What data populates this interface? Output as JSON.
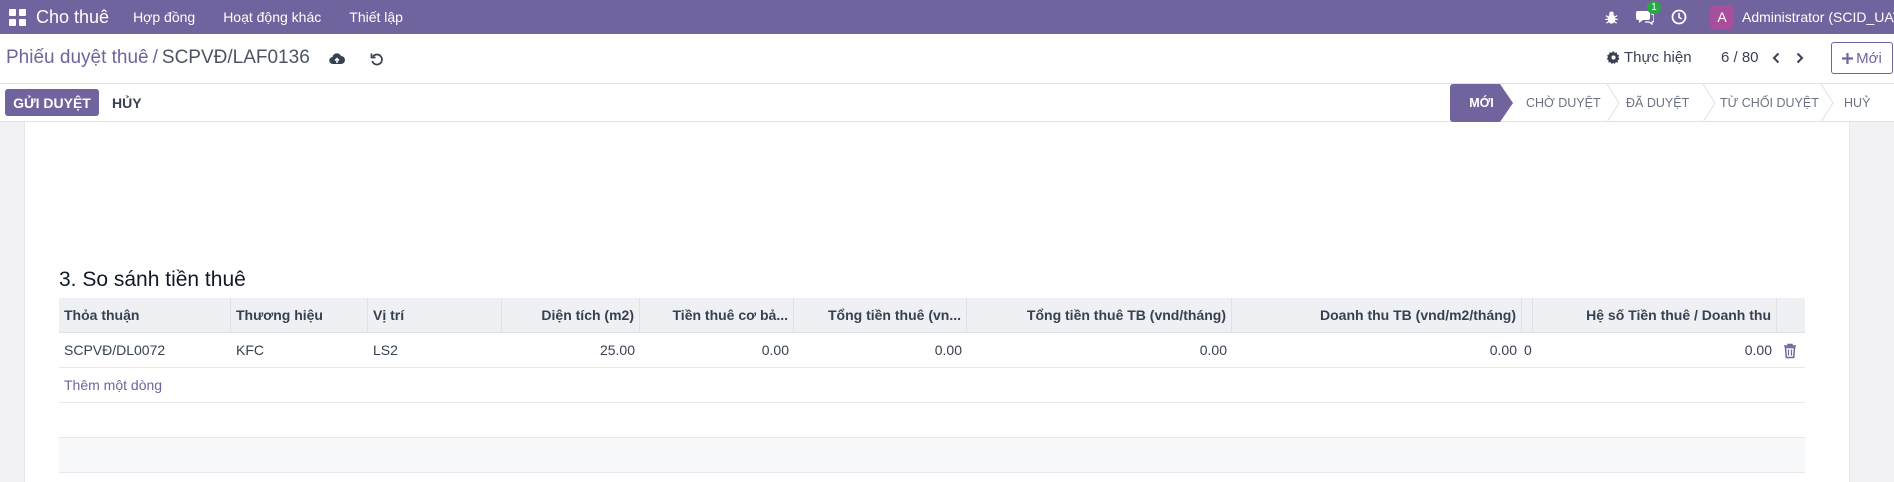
{
  "navbar": {
    "app_title": "Cho thuê",
    "menu": [
      "Hợp đồng",
      "Hoạt động khác",
      "Thiết lập"
    ],
    "messages_badge": "1",
    "avatar_letter": "A",
    "user": "Administrator (SCID_UAT)"
  },
  "control": {
    "breadcrumb_parent": "Phiếu duyệt thuê",
    "breadcrumb_sep": "/",
    "breadcrumb_current": "SCPVĐ/LAF0136",
    "action_label": "Thực hiện",
    "pager": "6 / 80",
    "new_label": "Mới"
  },
  "statusbar": {
    "submit_label": "GỬI DUYỆT",
    "cancel_label": "HỦY",
    "stages": [
      {
        "label": "MỚI",
        "active": true
      },
      {
        "label": "CHỜ DUYỆT",
        "active": false
      },
      {
        "label": "ĐÃ DUYỆT",
        "active": false
      },
      {
        "label": "TỪ CHỐI DUYỆT",
        "active": false
      },
      {
        "label": "HUỶ",
        "active": false
      }
    ]
  },
  "section": {
    "title": "3. So sánh tiền thuê"
  },
  "table": {
    "headers": [
      "Thỏa thuận",
      "Thương hiệu",
      "Vị trí",
      "Diện tích (m2)",
      "Tiền thuê cơ bả...",
      "Tổng tiền thuê (vn...",
      "Tổng tiền thuê TB (vnd/tháng)",
      "Doanh thu TB (vnd/m2/tháng)",
      "Hệ số Tiền thuê / Doanh thu"
    ],
    "rows": [
      {
        "agreement": "SCPVĐ/DL0072",
        "brand": "KFC",
        "location": "LS2",
        "area": "25.00",
        "base_rent": "0.00",
        "total_rent": "0.00",
        "avg_total_rent": "0.00",
        "avg_revenue": "0.00",
        "extra": "0",
        "ratio": "0.00"
      }
    ],
    "add_line_label": "Thêm một dòng"
  },
  "colors": {
    "brand": "#71639e",
    "badge": "#28a745",
    "avatar": "#a74e9c"
  },
  "icons": {
    "apps": "apps-grid-icon",
    "debug": "bug-icon",
    "messages": "chat-icon",
    "activity": "clock-icon",
    "save": "cloud-upload-icon",
    "discard": "undo-icon",
    "action": "gear-icon",
    "prev": "chevron-left-icon",
    "next": "chevron-right-icon",
    "new": "plus-icon",
    "delete": "trash-icon"
  }
}
